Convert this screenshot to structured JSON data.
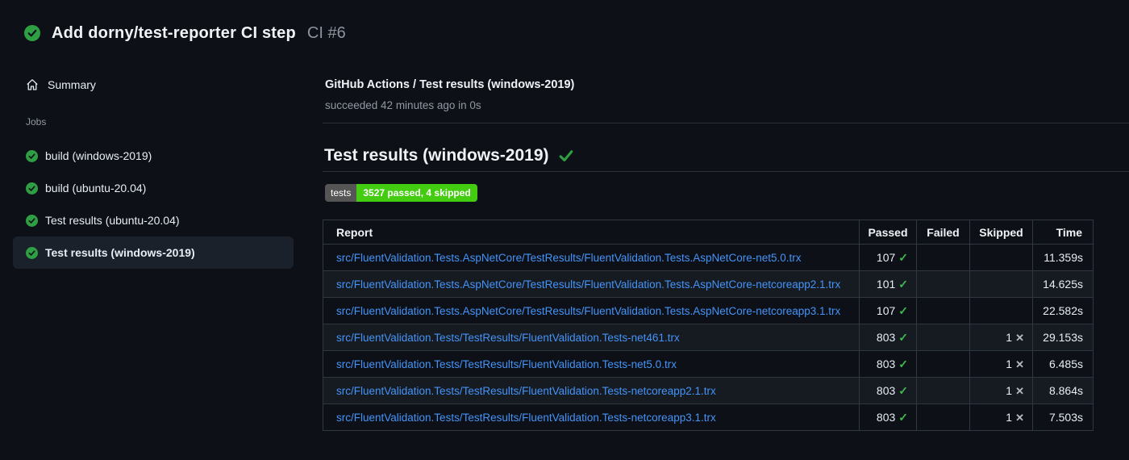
{
  "colors": {
    "page_bg": "#0d1117",
    "link_blue": "#4493f8",
    "success_green": "#2ea043",
    "check_green": "#3fb950",
    "badge_label_bg": "#555555",
    "badge_value_bg": "#44cc11",
    "selected_item_bg": "#1b212b"
  },
  "icons": {
    "passed_check": "✓",
    "skipped_cross": "✕"
  },
  "run_header": {
    "title": "Add dorny/test-reporter CI step",
    "run_number": "CI #6"
  },
  "sidebar": {
    "summary_label": "Summary",
    "jobs_section_label": "Jobs",
    "jobs": [
      {
        "label": "build (windows-2019)",
        "status": "success",
        "selected": false
      },
      {
        "label": "build (ubuntu-20.04)",
        "status": "success",
        "selected": false
      },
      {
        "label": "Test results (ubuntu-20.04)",
        "status": "success",
        "selected": false
      },
      {
        "label": "Test results (windows-2019)",
        "status": "success",
        "selected": true
      }
    ]
  },
  "job_header": {
    "title": "GitHub Actions / Test results (windows-2019)",
    "status_line": "succeeded 42 minutes ago in 0s"
  },
  "results": {
    "heading": "Test results (windows-2019)",
    "badge": {
      "label": "tests",
      "value": "3527 passed, 4 skipped"
    },
    "table": {
      "columns": [
        "Report",
        "Passed",
        "Failed",
        "Skipped",
        "Time"
      ],
      "rows": [
        {
          "report": "src/FluentValidation.Tests.AspNetCore/TestResults/FluentValidation.Tests.AspNetCore-net5.0.trx",
          "passed": "107",
          "failed": "",
          "skipped": "",
          "time": "11.359s"
        },
        {
          "report": "src/FluentValidation.Tests.AspNetCore/TestResults/FluentValidation.Tests.AspNetCore-netcoreapp2.1.trx",
          "passed": "101",
          "failed": "",
          "skipped": "",
          "time": "14.625s"
        },
        {
          "report": "src/FluentValidation.Tests.AspNetCore/TestResults/FluentValidation.Tests.AspNetCore-netcoreapp3.1.trx",
          "passed": "107",
          "failed": "",
          "skipped": "",
          "time": "22.582s"
        },
        {
          "report": "src/FluentValidation.Tests/TestResults/FluentValidation.Tests-net461.trx",
          "passed": "803",
          "failed": "",
          "skipped": "1",
          "time": "29.153s"
        },
        {
          "report": "src/FluentValidation.Tests/TestResults/FluentValidation.Tests-net5.0.trx",
          "passed": "803",
          "failed": "",
          "skipped": "1",
          "time": "6.485s"
        },
        {
          "report": "src/FluentValidation.Tests/TestResults/FluentValidation.Tests-netcoreapp2.1.trx",
          "passed": "803",
          "failed": "",
          "skipped": "1",
          "time": "8.864s"
        },
        {
          "report": "src/FluentValidation.Tests/TestResults/FluentValidation.Tests-netcoreapp3.1.trx",
          "passed": "803",
          "failed": "",
          "skipped": "1",
          "time": "7.503s"
        }
      ]
    }
  }
}
